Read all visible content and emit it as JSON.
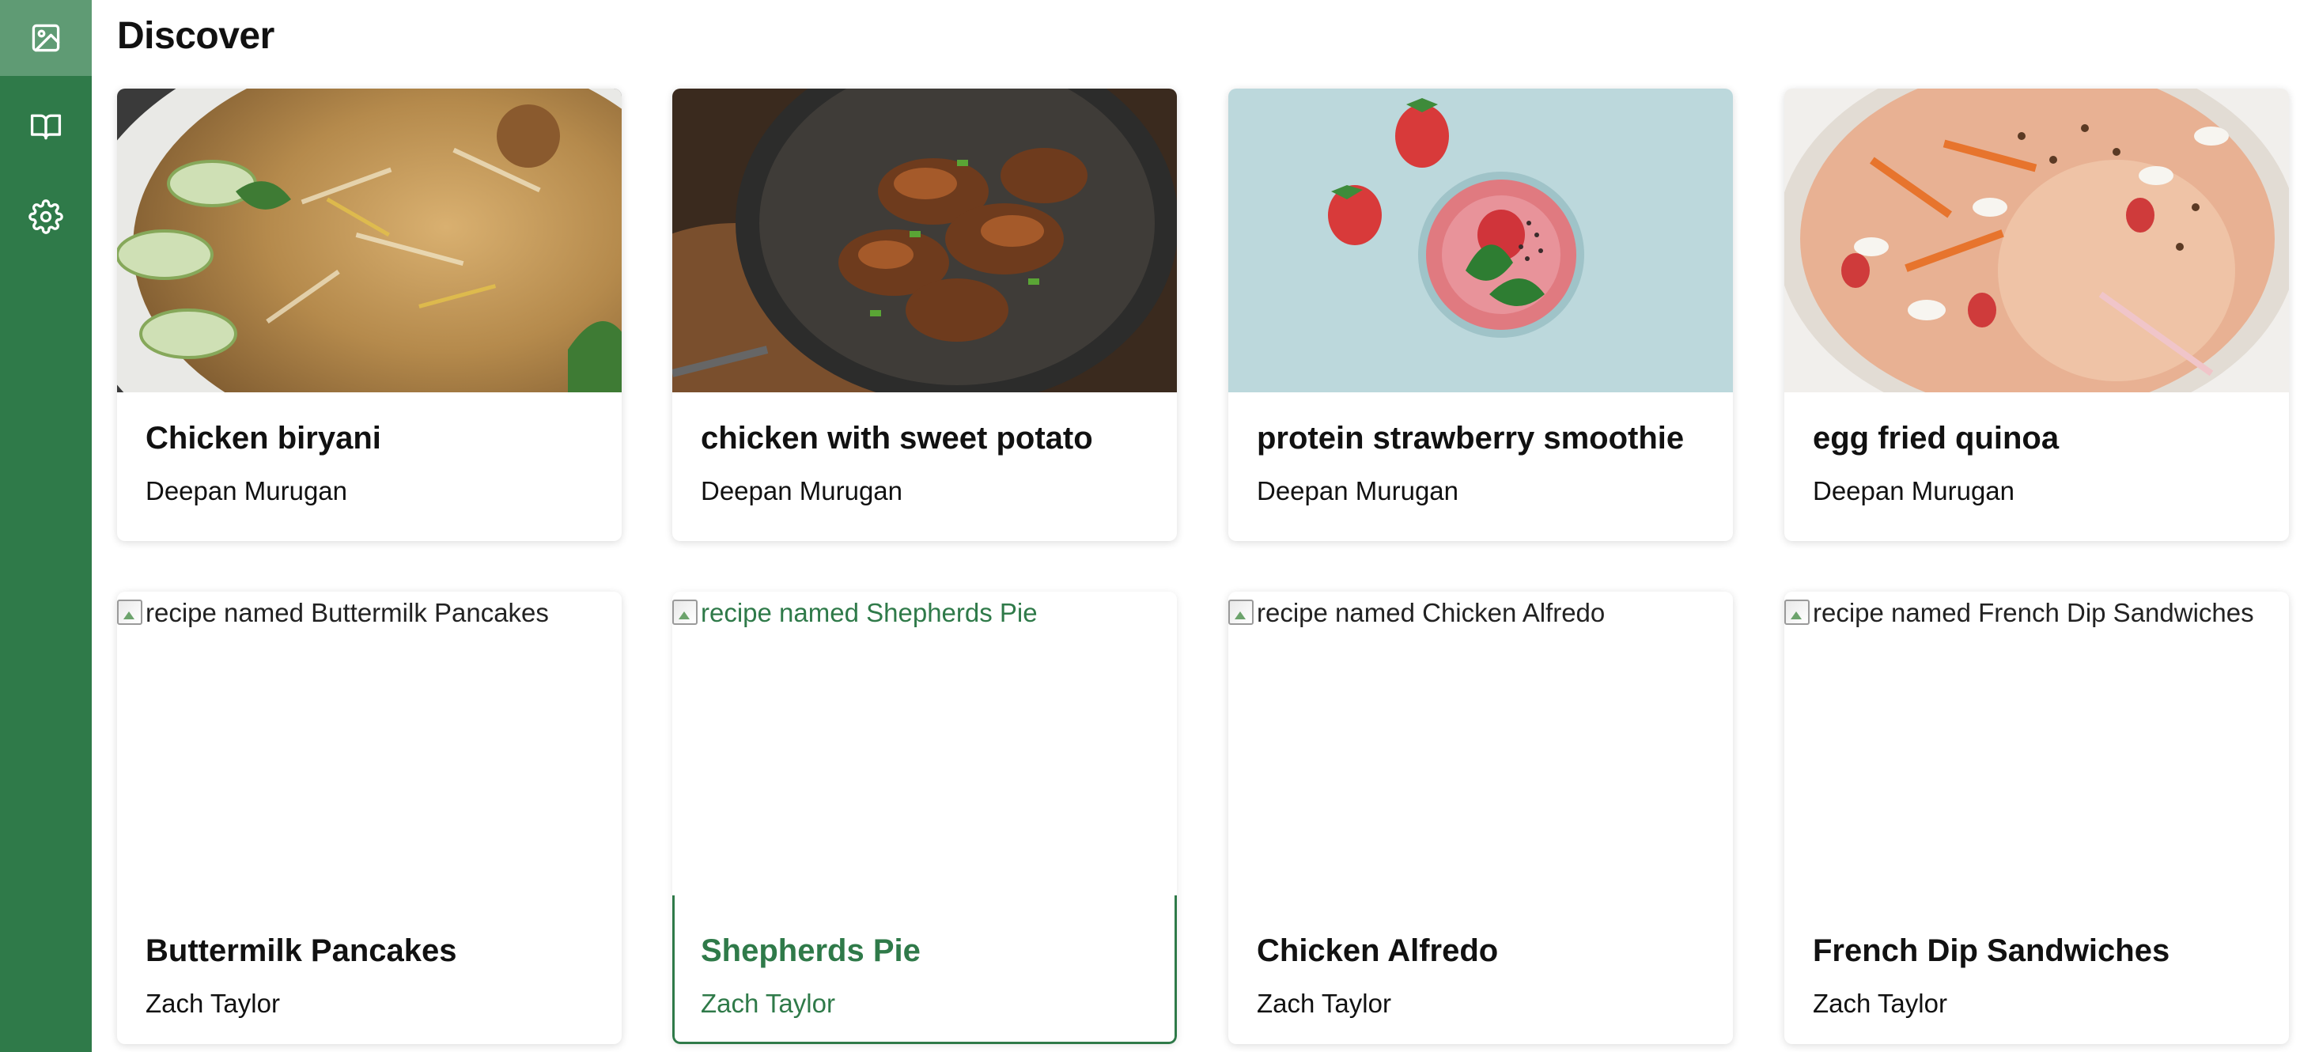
{
  "page": {
    "title": "Discover"
  },
  "sidebar": {
    "items": [
      {
        "icon": "image-icon",
        "label": "Discover",
        "active": true
      },
      {
        "icon": "book-icon",
        "label": "Recipes",
        "active": false
      },
      {
        "icon": "gear-icon",
        "label": "Settings",
        "active": false
      }
    ]
  },
  "theme": {
    "accent": "#2f7a49",
    "active_nav": "#5f9b74",
    "text": "#111111"
  },
  "recipes": [
    {
      "title": "Chicken biryani",
      "author": "Deepan Murugan",
      "image_alt": "recipe named Chicken biryani",
      "image_loaded": true
    },
    {
      "title": "chicken with sweet potato",
      "author": "Deepan Murugan",
      "image_alt": "recipe named chicken with sweet potato",
      "image_loaded": true
    },
    {
      "title": "protein strawberry smoothie",
      "author": "Deepan Murugan",
      "image_alt": "recipe named protein strawberry smoothie",
      "image_loaded": true
    },
    {
      "title": "egg fried quinoa",
      "author": "Deepan Murugan",
      "image_alt": "recipe named egg fried quinoa",
      "image_loaded": true
    },
    {
      "title": "Buttermilk Pancakes",
      "author": "Zach Taylor",
      "image_alt": "recipe named Buttermilk Pancakes",
      "image_loaded": false
    },
    {
      "title": "Shepherds Pie",
      "author": "Zach Taylor",
      "image_alt": "recipe named Shepherds Pie",
      "image_loaded": false,
      "selected": true
    },
    {
      "title": "Chicken Alfredo",
      "author": "Zach Taylor",
      "image_alt": "recipe named Chicken Alfredo",
      "image_loaded": false
    },
    {
      "title": "French Dip Sandwiches",
      "author": "Zach Taylor",
      "image_alt": "recipe named French Dip Sandwiches",
      "image_loaded": false
    }
  ]
}
